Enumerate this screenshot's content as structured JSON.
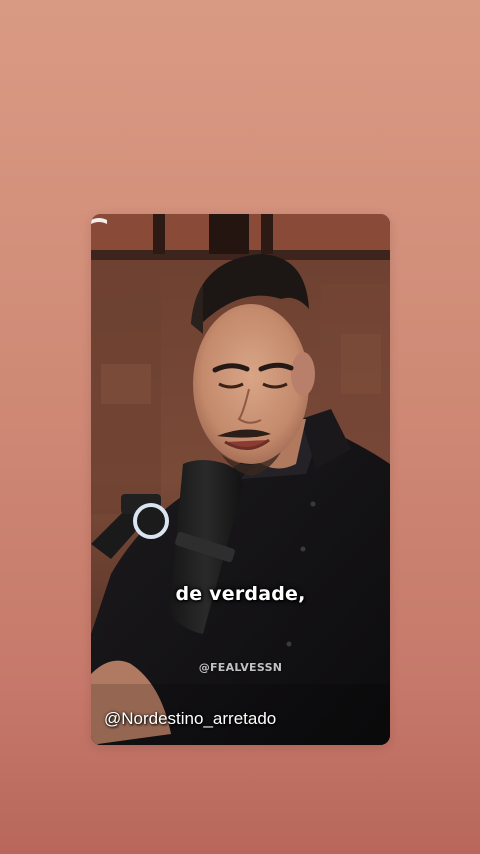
{
  "video": {
    "caption": "de verdade,",
    "watermark": "@FEALVESSN",
    "handle": "@Nordestino_arretado"
  },
  "colors": {
    "background_top": "#d99a84",
    "background_bottom": "#b8675a",
    "caption_text": "#ffffff"
  }
}
